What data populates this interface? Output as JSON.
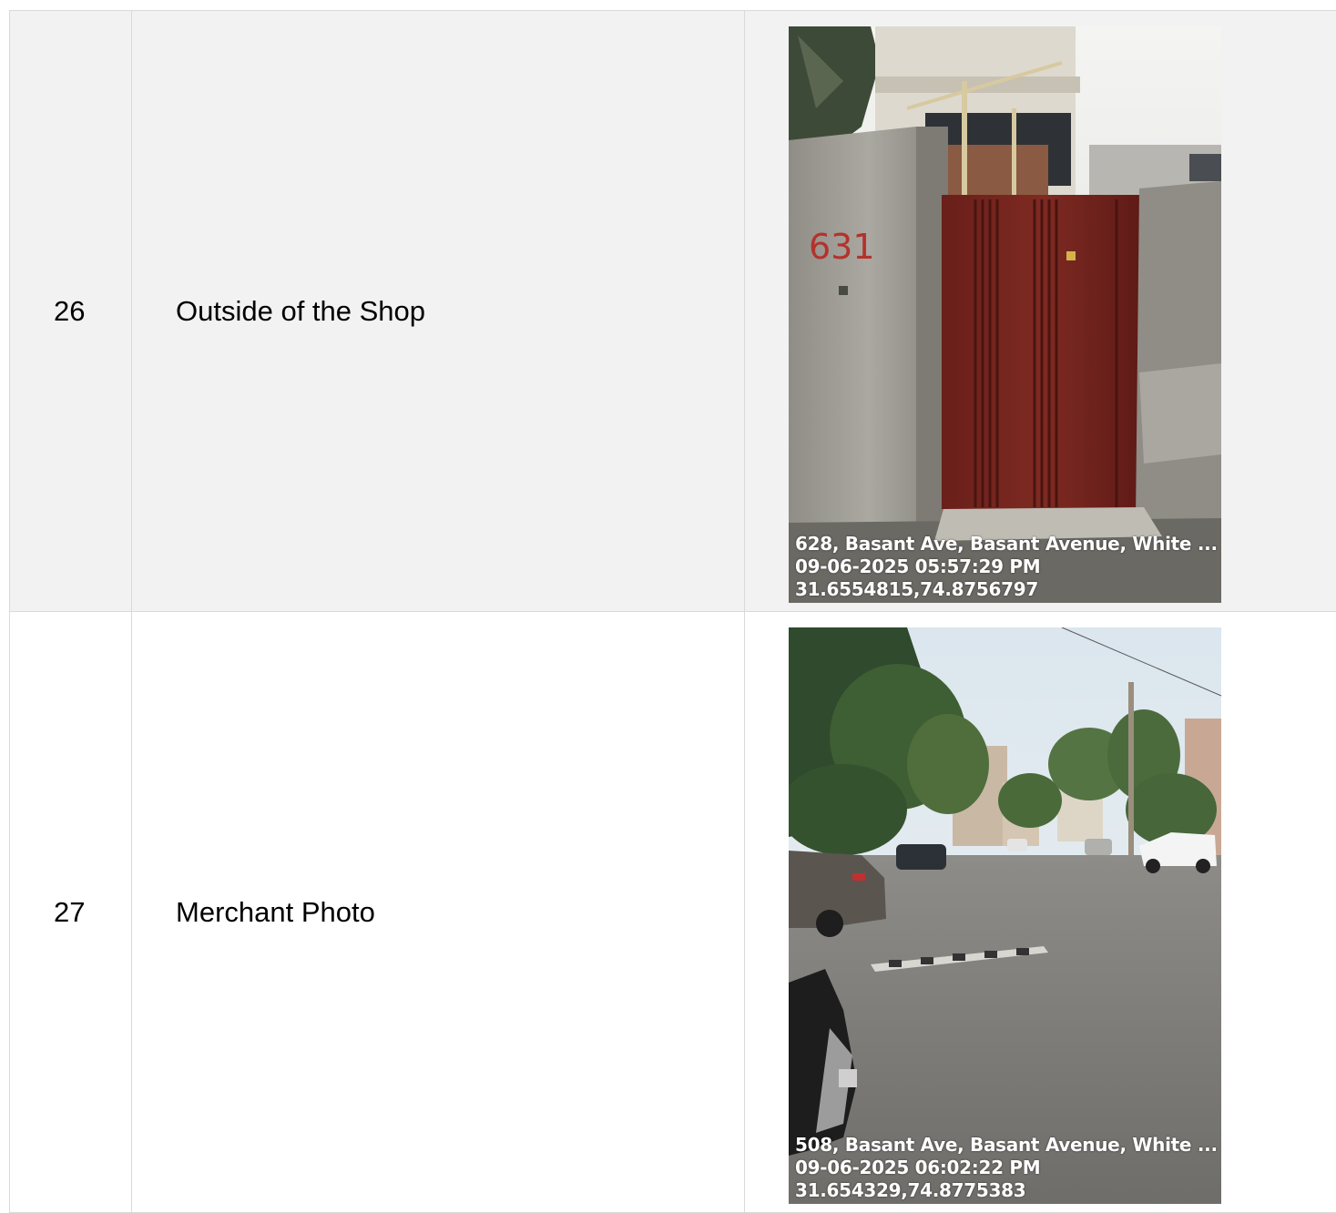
{
  "rows": [
    {
      "number": "26",
      "label": "Outside of the Shop",
      "photo": {
        "subject": "red metal gate in concrete wall",
        "wall_number": "631",
        "stamp_line1": "628, Basant Ave, Basant Avenue, White ...",
        "stamp_line2": "09-06-2025 05:57:29 PM",
        "stamp_line3": "31.6554815,74.8756797"
      }
    },
    {
      "number": "27",
      "label": "Merchant Photo",
      "photo": {
        "subject": "residential street with parked cars and trees",
        "stamp_line1": "508, Basant Ave, Basant Avenue, White ...",
        "stamp_line2": "09-06-2025 06:02:22 PM",
        "stamp_line3": "31.654329,74.8775383"
      }
    }
  ],
  "colors": {
    "row_odd_bg": "#f2f2f2",
    "row_even_bg": "#ffffff",
    "grid_line": "#d9d9d9",
    "gate_red": "#7a2620",
    "concrete": "#9c9a93"
  }
}
